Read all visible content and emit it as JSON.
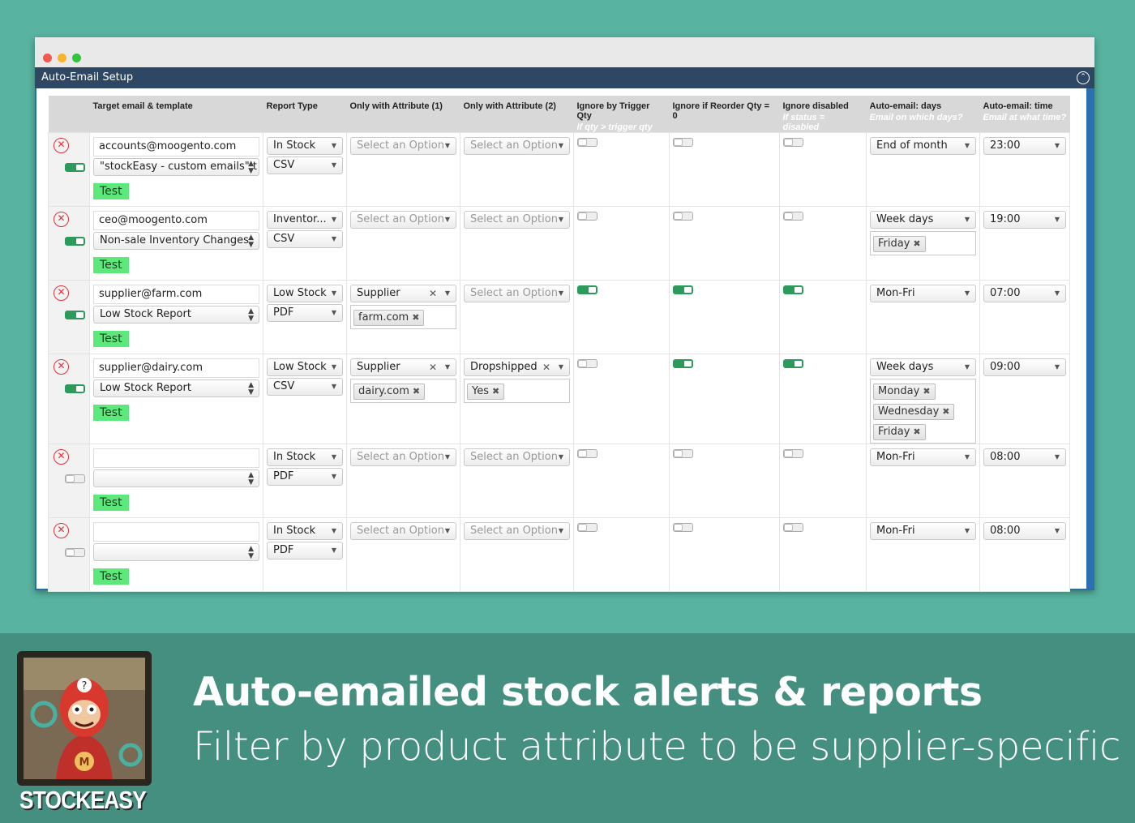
{
  "panel": {
    "title": "Auto-Email Setup"
  },
  "columns": [
    {
      "label": "Target email & template",
      "sub": ""
    },
    {
      "label": "Report Type",
      "sub": ""
    },
    {
      "label": "Only with Attribute (1)",
      "sub": ""
    },
    {
      "label": "Only with Attribute (2)",
      "sub": ""
    },
    {
      "label": "Ignore by Trigger Qty",
      "sub": "If qty > trigger qty"
    },
    {
      "label": "Ignore if Reorder Qty = 0",
      "sub": ""
    },
    {
      "label": "Ignore disabled",
      "sub": "If status = disabled"
    },
    {
      "label": "Auto-email: days",
      "sub": "Email on which days?"
    },
    {
      "label": "Auto-email: time",
      "sub": "Email at what time?"
    }
  ],
  "test_label": "Test",
  "placeholder_option": "Select an Option",
  "rows": [
    {
      "enabled": true,
      "email": "accounts@moogento.com",
      "template": "\"stockEasy - custom emails\" t",
      "report_type": "In Stock",
      "format": "CSV",
      "attr1": "",
      "attr1_tags": [],
      "attr2": "",
      "attr2_tags": [],
      "ignore_trigger": false,
      "ignore_reorder": false,
      "ignore_disabled": false,
      "days": "End of month",
      "day_tags": [],
      "time": "23:00"
    },
    {
      "enabled": true,
      "email": "ceo@moogento.com",
      "template": "Non-sale Inventory Changes",
      "report_type": "Inventor...",
      "format": "CSV",
      "attr1": "",
      "attr1_tags": [],
      "attr2": "",
      "attr2_tags": [],
      "ignore_trigger": false,
      "ignore_reorder": false,
      "ignore_disabled": false,
      "days": "Week days",
      "day_tags": [
        "Friday"
      ],
      "time": "19:00"
    },
    {
      "enabled": true,
      "email": "supplier@farm.com",
      "template": "Low Stock Report",
      "report_type": "Low Stock",
      "format": "PDF",
      "attr1": "Supplier",
      "attr1_tags": [
        "farm.com"
      ],
      "attr2": "",
      "attr2_tags": [],
      "ignore_trigger": true,
      "ignore_reorder": true,
      "ignore_disabled": true,
      "days": "Mon-Fri",
      "day_tags": [],
      "time": "07:00"
    },
    {
      "enabled": true,
      "email": "supplier@dairy.com",
      "template": "Low Stock Report",
      "report_type": "Low Stock",
      "format": "CSV",
      "attr1": "Supplier",
      "attr1_tags": [
        "dairy.com"
      ],
      "attr2": "Dropshipped",
      "attr2_tags": [
        "Yes"
      ],
      "ignore_trigger": false,
      "ignore_reorder": true,
      "ignore_disabled": true,
      "days": "Week days",
      "day_tags": [
        "Monday",
        "Wednesday",
        "Friday"
      ],
      "time": "09:00"
    },
    {
      "enabled": false,
      "email": "",
      "template": "",
      "report_type": "In Stock",
      "format": "PDF",
      "attr1": "",
      "attr1_tags": [],
      "attr2": "",
      "attr2_tags": [],
      "ignore_trigger": false,
      "ignore_reorder": false,
      "ignore_disabled": false,
      "days": "Mon-Fri",
      "day_tags": [],
      "time": "08:00"
    },
    {
      "enabled": false,
      "email": "",
      "template": "",
      "report_type": "In Stock",
      "format": "PDF",
      "attr1": "",
      "attr1_tags": [],
      "attr2": "",
      "attr2_tags": [],
      "ignore_trigger": false,
      "ignore_reorder": false,
      "ignore_disabled": false,
      "days": "Mon-Fri",
      "day_tags": [],
      "time": "08:00"
    }
  ],
  "banner": {
    "logo_text": "STOCKEASY",
    "headline": "Auto-emailed stock alerts & reports",
    "subline": "Filter by product attribute to be supplier-specific"
  },
  "colors": {
    "background": "#58b3a0",
    "banner": "#458f80",
    "panel_header": "#2e4763",
    "toggle_on": "#2c9a5a",
    "test_button": "#5de87b",
    "delete": "#e0303a"
  }
}
